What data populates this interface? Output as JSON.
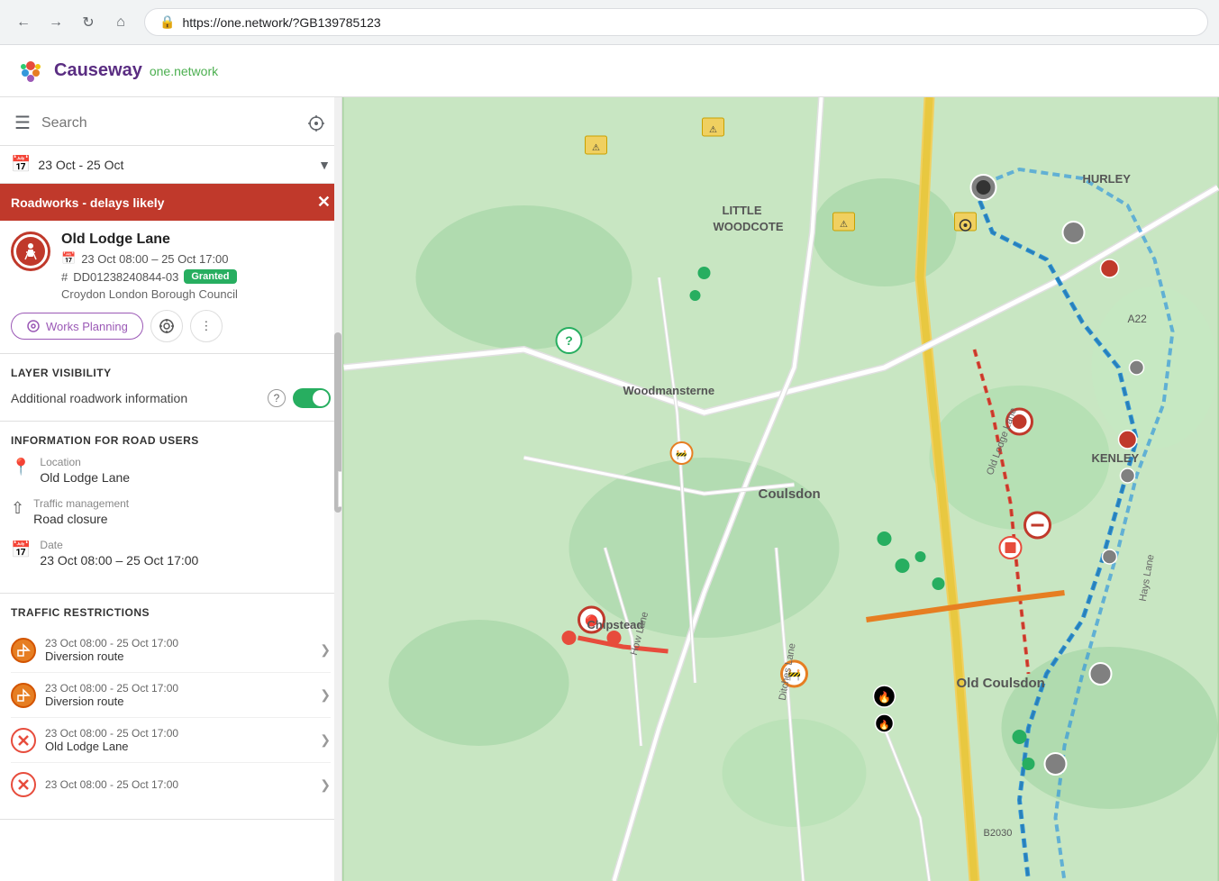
{
  "browser": {
    "url": "https://one.network/?GB139785123",
    "back_title": "Back",
    "forward_title": "Forward",
    "refresh_title": "Refresh",
    "home_title": "Home"
  },
  "header": {
    "logo_text": "Causeway",
    "logo_subtext": "one.network",
    "title": "Causeway one.network"
  },
  "sidebar": {
    "search_placeholder": "Search",
    "date_range": "23 Oct - 25 Oct",
    "banner": {
      "label": "Roadworks",
      "suffix": " - delays likely"
    },
    "incident": {
      "title": "Old Lodge Lane",
      "date": "23 Oct 08:00 – 25 Oct 17:00",
      "ref": "DD01238240844-03",
      "badge": "Granted",
      "authority": "Croydon London Borough Council"
    },
    "works_planning_btn": "Works Planning",
    "layer_visibility": {
      "title": "LAYER VISIBILITY",
      "label": "Additional roadwork information"
    },
    "road_users": {
      "title": "INFORMATION FOR ROAD USERS",
      "location_label": "Location",
      "location_value": "Old Lodge Lane",
      "traffic_label": "Traffic management",
      "traffic_value": "Road closure",
      "date_label": "Date",
      "date_value": "23 Oct 08:00 – 25 Oct 17:00"
    },
    "restrictions": {
      "title": "TRAFFIC RESTRICTIONS",
      "items": [
        {
          "date": "23 Oct 08:00 - 25 Oct 17:00",
          "type": "Diversion route",
          "icon_type": "diversion"
        },
        {
          "date": "23 Oct 08:00 - 25 Oct 17:00",
          "type": "Diversion route",
          "icon_type": "diversion"
        },
        {
          "date": "23 Oct 08:00 - 25 Oct 17:00",
          "type": "Old Lodge Lane",
          "icon_type": "closure"
        },
        {
          "date": "23 Oct 08:00 - 25 Oct 17:00",
          "type": "",
          "icon_type": "closure_partial"
        }
      ]
    }
  },
  "map": {
    "labels": [
      "LITTLE WOODCOTE",
      "Woodmansterne",
      "Coulsdon",
      "Chipstead",
      "Old Coulsdon",
      "KENLEY",
      "B2030",
      "A22",
      "Old Lodge Lane",
      "Ditches Lane",
      "How Lane",
      "Hays Lane"
    ]
  }
}
